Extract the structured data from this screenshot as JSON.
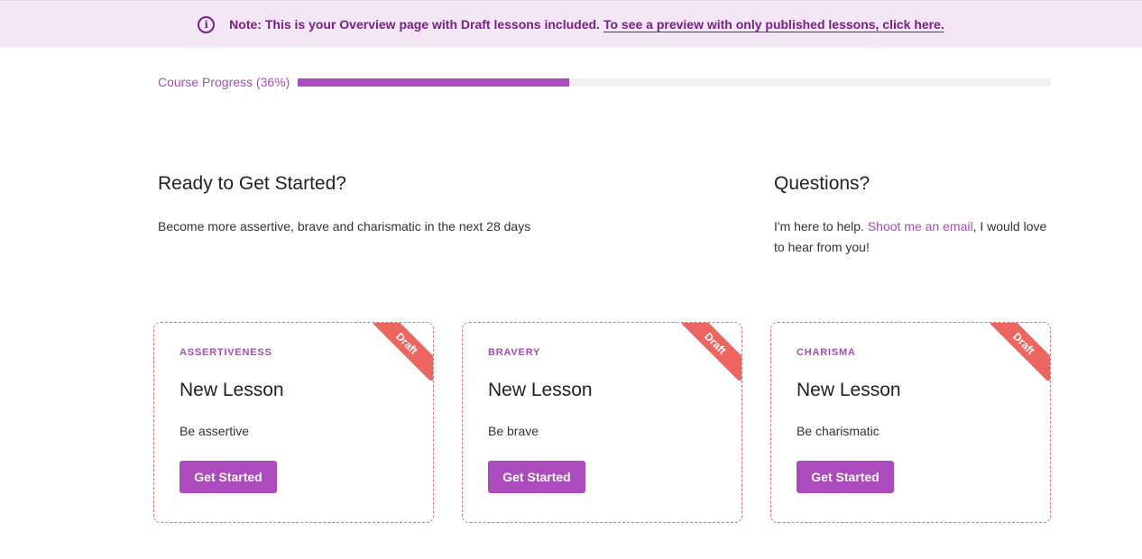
{
  "banner": {
    "note": "Note: This is your Overview page with Draft lessons included.",
    "link": "To see a preview with only published lessons, click here.",
    "icon": "info-icon"
  },
  "progress": {
    "label": "Course Progress (36%)",
    "percent": 36
  },
  "intro": {
    "title": "Ready to Get Started?",
    "text": "Become more assertive, brave and charismatic in the next 28 days"
  },
  "questions": {
    "title": "Questions?",
    "text_before": "I'm here to help. ",
    "link": "Shoot me an email",
    "text_after": ", I would love to hear from you!"
  },
  "lessons": [
    {
      "badge": "Draft",
      "category": "ASSERTIVENESS",
      "title": "New Lesson",
      "description": "Be assertive",
      "button": "Get Started"
    },
    {
      "badge": "Draft",
      "category": "BRAVERY",
      "title": "New Lesson",
      "description": "Be brave",
      "button": "Get Started"
    },
    {
      "badge": "Draft",
      "category": "CHARISMA",
      "title": "New Lesson",
      "description": "Be charismatic",
      "button": "Get Started"
    }
  ],
  "colors": {
    "accent": "#ab4bbd",
    "banner_bg": "#f3e7f5",
    "banner_text": "#7a1f86",
    "draft_ribbon": "#ec6560"
  }
}
